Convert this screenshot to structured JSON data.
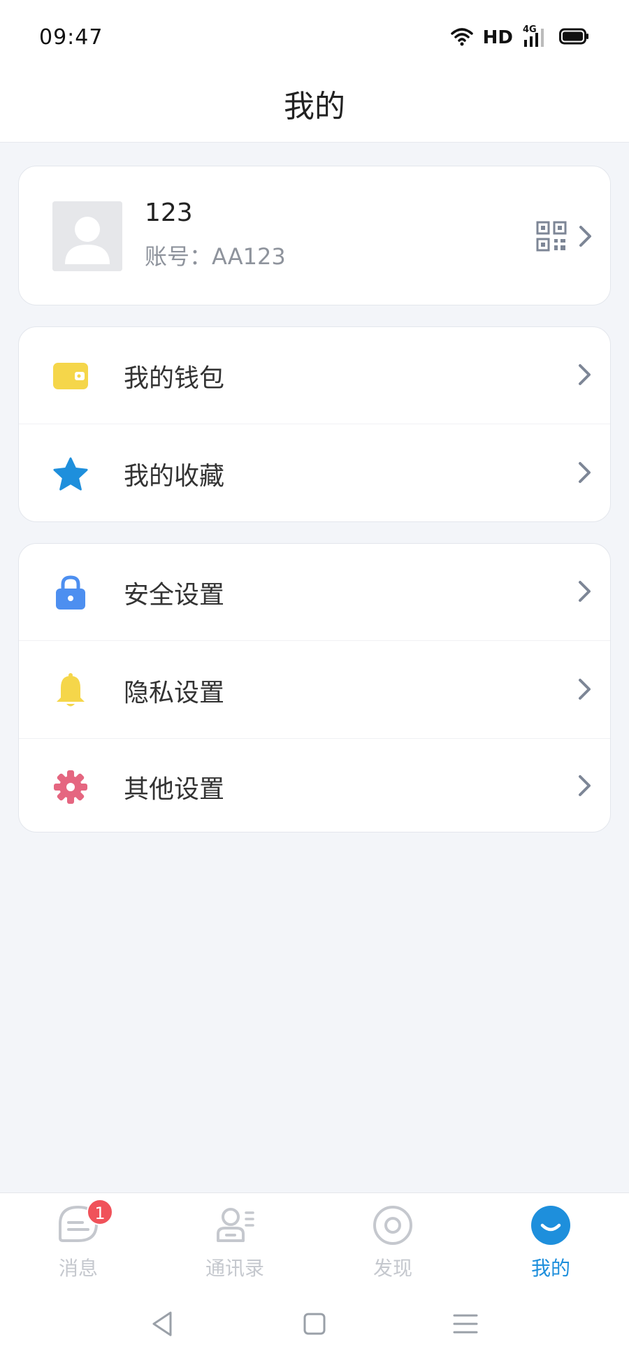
{
  "status_bar": {
    "time": "09:47",
    "network_label": "HD",
    "cellular_label": "4G",
    "icons": [
      "wifi-icon",
      "signal-icon",
      "battery-icon"
    ]
  },
  "header": {
    "title": "我的"
  },
  "profile": {
    "name": "123",
    "account": "账号：AA123",
    "icons": [
      "avatar-placeholder-icon",
      "qr-code-icon",
      "chevron-right-icon"
    ]
  },
  "menu_group_1": [
    {
      "label": "我的钱包",
      "icon": "wallet-icon",
      "color": "#f5d64a"
    },
    {
      "label": "我的收藏",
      "icon": "star-icon",
      "color": "#1e8fdc"
    }
  ],
  "menu_group_2": [
    {
      "label": "安全设置",
      "icon": "lock-icon",
      "color": "#4d8ff0"
    },
    {
      "label": "隐私设置",
      "icon": "bell-icon",
      "color": "#f5d64a"
    },
    {
      "label": "其他设置",
      "icon": "gear-icon",
      "color": "#e56680"
    }
  ],
  "bottom_nav": {
    "items": [
      {
        "label": "消息",
        "icon": "message-icon",
        "badge": "1",
        "active": false
      },
      {
        "label": "通讯录",
        "icon": "contacts-icon",
        "active": false
      },
      {
        "label": "发现",
        "icon": "discover-icon",
        "active": false
      },
      {
        "label": "我的",
        "icon": "me-smile-icon",
        "active": true
      }
    ],
    "active_color": "#1e8fdc",
    "inactive_color": "#c5c8ce"
  },
  "system_nav": {
    "icons": [
      "back-icon",
      "home-icon",
      "menu-icon"
    ]
  }
}
